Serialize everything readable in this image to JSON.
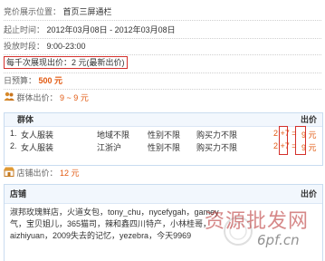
{
  "info": {
    "position_label": "竞价展示位置：",
    "position_value": "首页三屏通栏",
    "time_label": "起止时间：",
    "time_value": "2012年03月08日 - 2012年03月08日",
    "period_label": "投放时段：",
    "period_value": "9:00-23:00",
    "bid_text": "每千次展现出价：2 元(最新出价)",
    "budget_label": "日预算：",
    "budget_value": "500 元"
  },
  "crowd": {
    "label": "群体出价：",
    "range": "9 ~ 9 元",
    "header_title": "群体",
    "header_bid": "出价",
    "rows": [
      {
        "num": "1.",
        "name": "女人服装",
        "region": "地域不限",
        "gender": "性别不限",
        "power": "购买力不限",
        "calc": "2 +7 =",
        "total": "9 元"
      },
      {
        "num": "2.",
        "name": "女人服装",
        "region": "江浙沪",
        "gender": "性别不限",
        "power": "购买力不限",
        "calc": "2 +7 =",
        "total": "9 元"
      }
    ]
  },
  "shop": {
    "label": "店铺出价：",
    "value": "12 元",
    "header_title": "店铺",
    "header_bid": "出价",
    "names_line1": "淑邦玫瑰鲜店，火道女包，tony_chu，nycefygah，gamey",
    "names_line2": "气，宝贝姐儿，365猫司，辣和鑫四川特产，小林桂哥，",
    "names_line3": "aizhiyuan，2009失去的记忆，yezebra，今天9969"
  },
  "watermark": {
    "text_cn": "资源批发网",
    "text_url": "6pf.cn"
  },
  "colors": {
    "accent_red": "#d4302c",
    "price_orange": "#e25a12",
    "panel_border": "#c9dcf0"
  },
  "icons": [
    "people-icon",
    "shop-icon"
  ]
}
